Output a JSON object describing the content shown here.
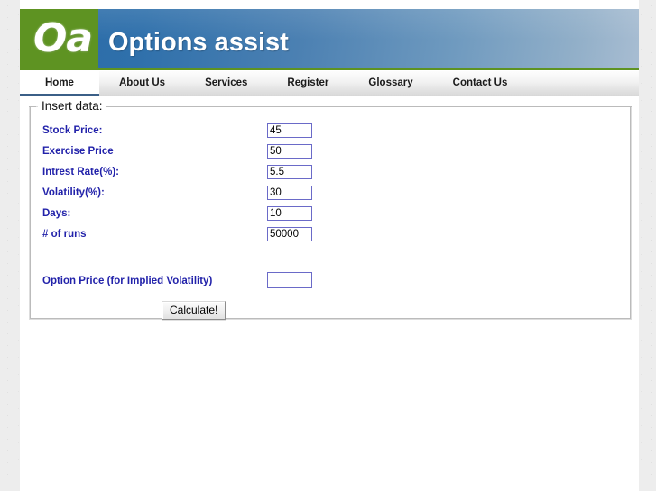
{
  "site": {
    "logo_text": "Oa",
    "title": "Options assist",
    "brand_green": "#5e9322",
    "brand_blue": "#2a6ba8",
    "label_blue": "#2222aa"
  },
  "nav": {
    "items": [
      {
        "label": "Home",
        "active": true
      },
      {
        "label": "About Us",
        "active": false
      },
      {
        "label": "Services",
        "active": false
      },
      {
        "label": "Register",
        "active": false
      },
      {
        "label": "Glossary",
        "active": false
      },
      {
        "label": "Contact Us",
        "active": false
      }
    ]
  },
  "form": {
    "legend": "Insert data:",
    "fields": [
      {
        "label": "Stock Price:",
        "value": "45",
        "placeholder": ""
      },
      {
        "label": "Exercise Price",
        "value": "50",
        "placeholder": ""
      },
      {
        "label": "Intrest Rate(%):",
        "value": "5.5",
        "placeholder": ""
      },
      {
        "label": "Volatility(%):",
        "value": "30",
        "placeholder": ""
      },
      {
        "label": "Days:",
        "value": "10",
        "placeholder": ""
      },
      {
        "label": "# of runs",
        "value": "50000",
        "placeholder": ""
      }
    ],
    "implied": {
      "label": "Option Price (for Implied Volatility)",
      "value": "",
      "placeholder": ""
    },
    "submit_label": "Calculate!"
  }
}
